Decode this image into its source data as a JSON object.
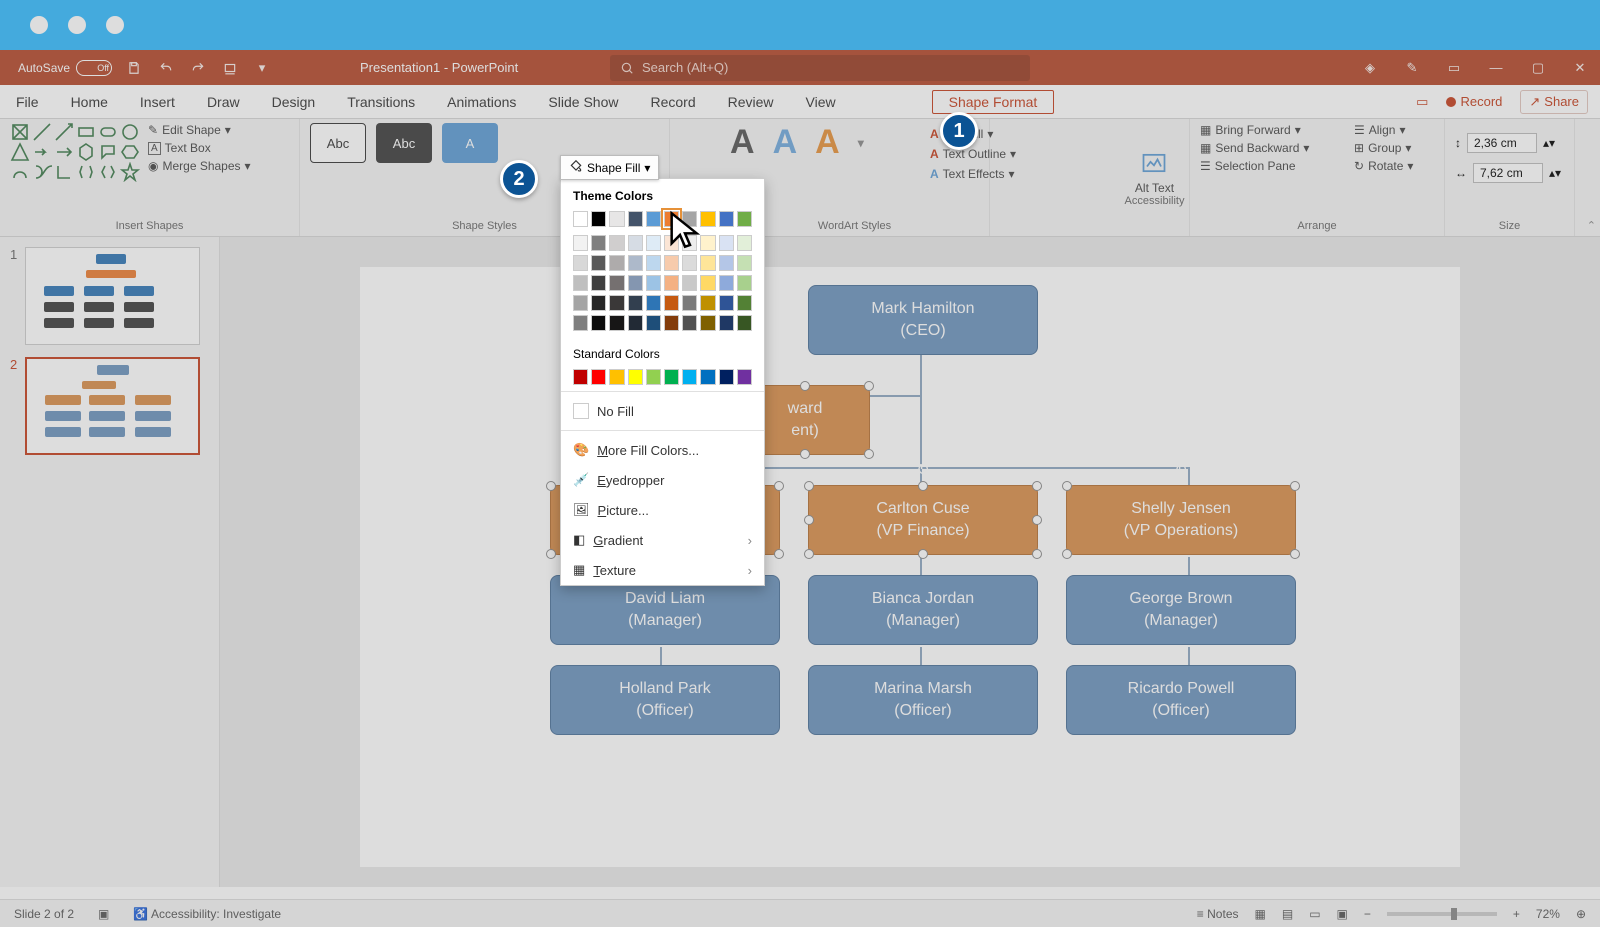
{
  "qat": {
    "autosave_label": "AutoSave",
    "autosave_state": "Off",
    "title": "Presentation1 - PowerPoint",
    "search_placeholder": "Search (Alt+Q)"
  },
  "menu": {
    "items": [
      "File",
      "Home",
      "Insert",
      "Draw",
      "Design",
      "Transitions",
      "Animations",
      "Slide Show",
      "Record",
      "Review",
      "View"
    ],
    "active": "Shape Format",
    "record": "Record",
    "share": "Share",
    "comments_icon": "comments-icon"
  },
  "ribbon": {
    "insert_shapes": {
      "label": "Insert Shapes",
      "edit_shape": "Edit Shape",
      "text_box": "Text Box",
      "merge_shapes": "Merge Shapes"
    },
    "shape_styles": {
      "label": "Shape Styles",
      "shape_fill": "Shape Fill"
    },
    "wordart": {
      "label": "WordArt Styles",
      "text_fill": "Text Fill",
      "text_outline": "Text Outline",
      "text_effects": "Text Effects"
    },
    "accessibility": {
      "label": "Accessibility",
      "alt_text": "Alt Text"
    },
    "arrange": {
      "label": "Arrange",
      "bring_forward": "Bring Forward",
      "send_backward": "Send Backward",
      "selection_pane": "Selection Pane",
      "align": "Align",
      "group": "Group",
      "rotate": "Rotate"
    },
    "size": {
      "label": "Size",
      "height": "2,36 cm",
      "width": "7,62 cm"
    }
  },
  "dropdown": {
    "theme_colors_title": "Theme Colors",
    "standard_colors_title": "Standard Colors",
    "no_fill": "No Fill",
    "more_colors": "More Fill Colors...",
    "eyedropper": "Eyedropper",
    "picture": "Picture...",
    "gradient": "Gradient",
    "texture": "Texture",
    "theme_row1": [
      "#ffffff",
      "#000000",
      "#e7e6e6",
      "#44546a",
      "#5b9bd5",
      "#ed7d31",
      "#a5a5a5",
      "#ffc000",
      "#4472c4",
      "#70ad47"
    ],
    "theme_shades": [
      [
        "#f2f2f2",
        "#7f7f7f",
        "#d0cece",
        "#d6dce4",
        "#deebf6",
        "#fbe5d5",
        "#ededed",
        "#fff2cc",
        "#d9e2f3",
        "#e2efd9"
      ],
      [
        "#d8d8d8",
        "#595959",
        "#aeabab",
        "#adb9ca",
        "#bdd7ee",
        "#f7cbac",
        "#dbdbdb",
        "#fee599",
        "#b4c6e7",
        "#c5e0b3"
      ],
      [
        "#bfbfbf",
        "#3f3f3f",
        "#757070",
        "#8496b0",
        "#9cc3e5",
        "#f4b183",
        "#c9c9c9",
        "#ffd965",
        "#8eaadb",
        "#a8d08d"
      ],
      [
        "#a5a5a5",
        "#262626",
        "#3a3838",
        "#323f4f",
        "#2e75b5",
        "#c55a11",
        "#7b7b7b",
        "#bf9000",
        "#2f5496",
        "#538135"
      ],
      [
        "#7f7f7f",
        "#0c0c0c",
        "#171616",
        "#222a35",
        "#1e4e79",
        "#833c0b",
        "#525252",
        "#7f6000",
        "#1f3864",
        "#375623"
      ]
    ],
    "standard_row": [
      "#c00000",
      "#ff0000",
      "#ffc000",
      "#ffff00",
      "#92d050",
      "#00b050",
      "#00b0f0",
      "#0070c0",
      "#002060",
      "#7030a0"
    ]
  },
  "org": {
    "ceo": {
      "name": "Mark Hamilton",
      "role": "(CEO)"
    },
    "assistant": {
      "name": "ward",
      "role": "ent)"
    },
    "vp_finance": {
      "name": "Carlton Cuse",
      "role": "(VP Finance)"
    },
    "vp_ops": {
      "name": "Shelly Jensen",
      "role": "(VP Operations)"
    },
    "mgr1": {
      "name": "David Liam",
      "role": "(Manager)"
    },
    "mgr2": {
      "name": "Bianca Jordan",
      "role": "(Manager)"
    },
    "mgr3": {
      "name": "George Brown",
      "role": "(Manager)"
    },
    "off1": {
      "name": "Holland Park",
      "role": "(Officer)"
    },
    "off2": {
      "name": "Marina Marsh",
      "role": "(Officer)"
    },
    "off3": {
      "name": "Ricardo Powell",
      "role": "(Officer)"
    }
  },
  "status": {
    "slide": "Slide 2 of 2",
    "accessibility": "Accessibility: Investigate",
    "notes": "Notes",
    "zoom": "72%"
  },
  "callouts": {
    "one": "1",
    "two": "2"
  }
}
